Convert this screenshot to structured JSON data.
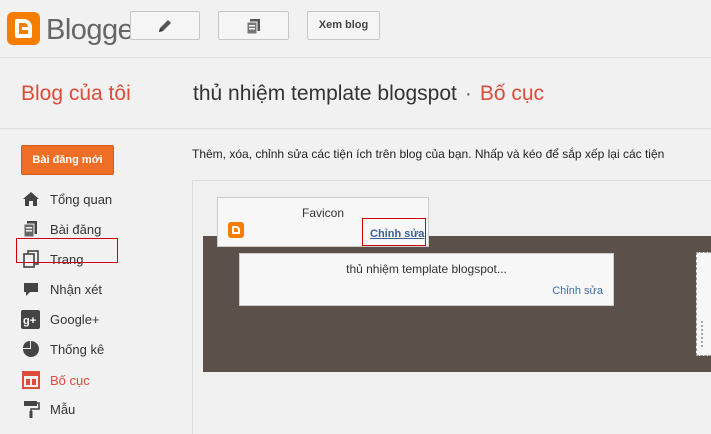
{
  "topbar": {
    "brand": "Blogger",
    "pencil_icon": "pencil-icon",
    "posts_icon": "posts-icon",
    "view_blog_label": "Xem blog"
  },
  "header": {
    "my_blogs": "Blog của tôi",
    "blog_title": "thủ nhiệm template blogspot",
    "separator": "·",
    "current_page": "Bố cục"
  },
  "sidebar": {
    "new_post_label": "Bài đăng mới",
    "items": [
      {
        "label": "Tổng quan",
        "icon": "home-icon"
      },
      {
        "label": "Bài đăng",
        "icon": "posts-icon"
      },
      {
        "label": "Trang",
        "icon": "pages-icon"
      },
      {
        "label": "Nhận xét",
        "icon": "comment-icon"
      },
      {
        "label": "Google+",
        "icon": "google-plus-icon"
      },
      {
        "label": "Thống kê",
        "icon": "pie-chart-icon"
      },
      {
        "label": "Bố cục",
        "icon": "layout-icon",
        "active": true
      },
      {
        "label": "Mẫu",
        "icon": "paint-roller-icon"
      }
    ]
  },
  "main": {
    "description": "Thêm, xóa, chỉnh sửa các tiện ích trên blog của bạn. Nhấp và kéo để sắp xếp lại các tiện",
    "gadgets": {
      "favicon": {
        "title": "Favicon",
        "edit_label": "Chỉnh sửa"
      },
      "header": {
        "title": "thủ nhiệm template blogspot...",
        "edit_label": "Chỉnh sửa"
      }
    }
  },
  "colors": {
    "accent": "#dd4b39",
    "brand_orange": "#f57d00",
    "button_orange": "#ee6e26",
    "layout_dark": "#5b504a"
  }
}
